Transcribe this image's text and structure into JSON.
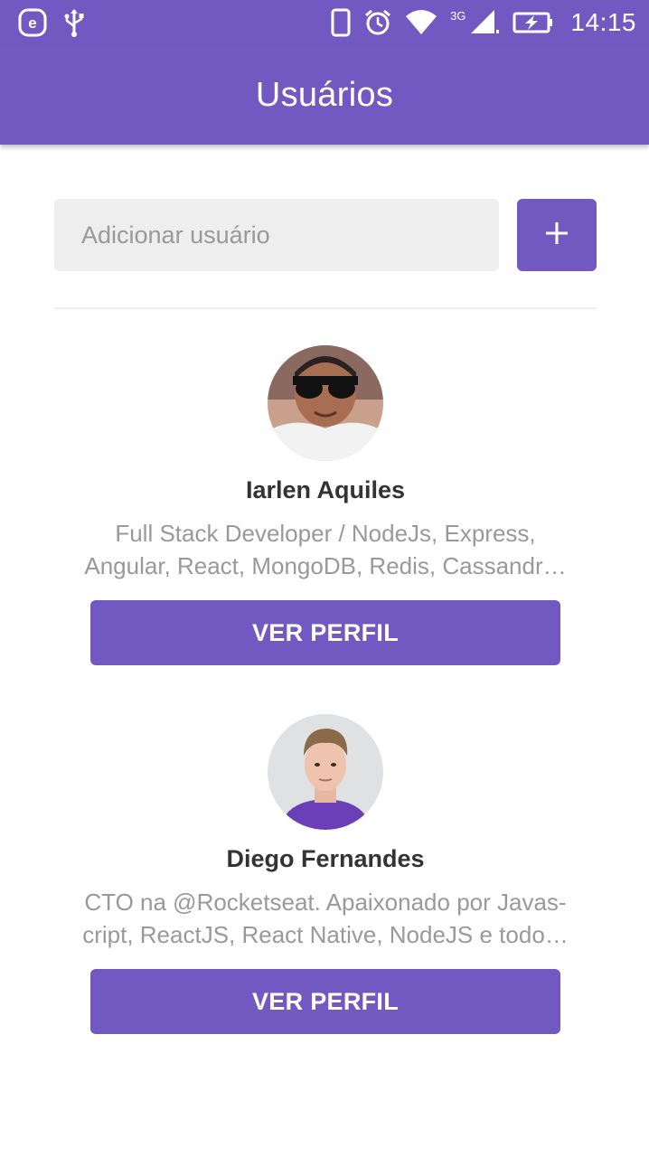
{
  "status_bar": {
    "network_label": "3G",
    "time": "14:15"
  },
  "app_bar": {
    "title": "Usuários"
  },
  "form": {
    "input_placeholder": "Adicionar usuário",
    "add_label": "+"
  },
  "users": [
    {
      "name": "Iarlen Aquiles",
      "bio_line1": "Full Stack Developer / NodeJs, Express,",
      "bio_line2": "Angular, React, MongoDB, Redis, Cassandr…",
      "button_label": "VER PERFIL"
    },
    {
      "name": "Diego Fernandes",
      "bio_line1": "CTO na @Rocketseat. Apaixonado por Javas-",
      "bio_line2": "cript, ReactJS, React Native, NodeJS e todo…",
      "button_label": "VER PERFIL"
    }
  ],
  "colors": {
    "primary": "#7159c1",
    "input_background": "#eeeeee",
    "placeholder": "#999999",
    "name_text": "#333333"
  }
}
